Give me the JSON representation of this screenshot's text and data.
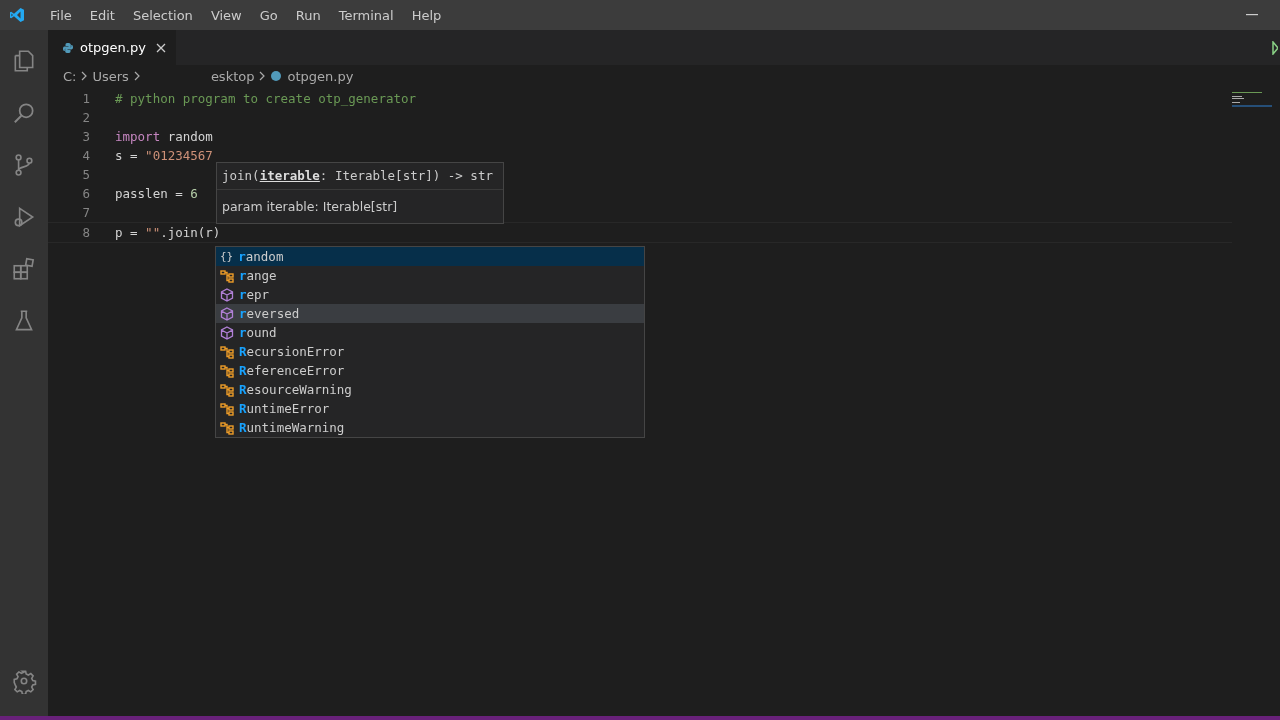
{
  "menu": [
    "File",
    "Edit",
    "Selection",
    "View",
    "Go",
    "Run",
    "Terminal",
    "Help"
  ],
  "tabs": [
    {
      "label": "otpgen.py",
      "selected": true
    }
  ],
  "breadcrumb": [
    "C:",
    "Users",
    "esktop",
    "otpgen.py"
  ],
  "code": [
    {
      "number": "1",
      "tokens": [
        {
          "kind": "comment",
          "text": "# python program to create otp_generator"
        }
      ]
    },
    {
      "number": "2"
    },
    {
      "number": "3",
      "tokens": [
        {
          "kind": "keyword",
          "text": "import"
        },
        {
          "kind": "plain",
          "text": " random"
        }
      ]
    },
    {
      "number": "4",
      "tokens": [
        {
          "kind": "plain",
          "text": "s = "
        },
        {
          "kind": "string",
          "text": "\"01234567"
        }
      ]
    },
    {
      "number": "5"
    },
    {
      "number": "6",
      "tokens": [
        {
          "kind": "plain",
          "text": "passlen = "
        },
        {
          "kind": "number",
          "text": "6"
        }
      ]
    },
    {
      "number": "7"
    },
    {
      "number": "8",
      "tokens": [
        {
          "kind": "plain",
          "text": "p = "
        },
        {
          "kind": "string",
          "text": "\"\""
        },
        {
          "kind": "plain",
          "text": ".join(r)"
        }
      ]
    }
  ],
  "signature": {
    "name": "join(",
    "param": "iterable",
    "rest": ": Iterable[str]) -> str",
    "doc": "param iterable: Iterable[str]"
  },
  "suggestions": [
    {
      "kind": "module",
      "icon": "{}",
      "match": "r",
      "rest": "andom",
      "selected": true,
      "hovered": false
    },
    {
      "kind": "class",
      "match": "r",
      "rest": "ange",
      "selected": false,
      "hovered": false
    },
    {
      "kind": "function",
      "match": "r",
      "rest": "epr",
      "selected": false,
      "hovered": false
    },
    {
      "kind": "function",
      "match": "r",
      "rest": "eversed",
      "selected": false,
      "hovered": true
    },
    {
      "kind": "function",
      "match": "r",
      "rest": "ound",
      "selected": false,
      "hovered": false
    },
    {
      "kind": "class",
      "match": "R",
      "rest": "ecursionError",
      "selected": false,
      "hovered": false
    },
    {
      "kind": "class",
      "match": "R",
      "rest": "eferenceError",
      "selected": false,
      "hovered": false
    },
    {
      "kind": "class",
      "match": "R",
      "rest": "esourceWarning",
      "selected": false,
      "hovered": false
    },
    {
      "kind": "class",
      "match": "R",
      "rest": "untimeError",
      "selected": false,
      "hovered": false
    },
    {
      "kind": "class",
      "match": "R",
      "rest": "untimeWarning",
      "selected": false,
      "hovered": false
    }
  ]
}
